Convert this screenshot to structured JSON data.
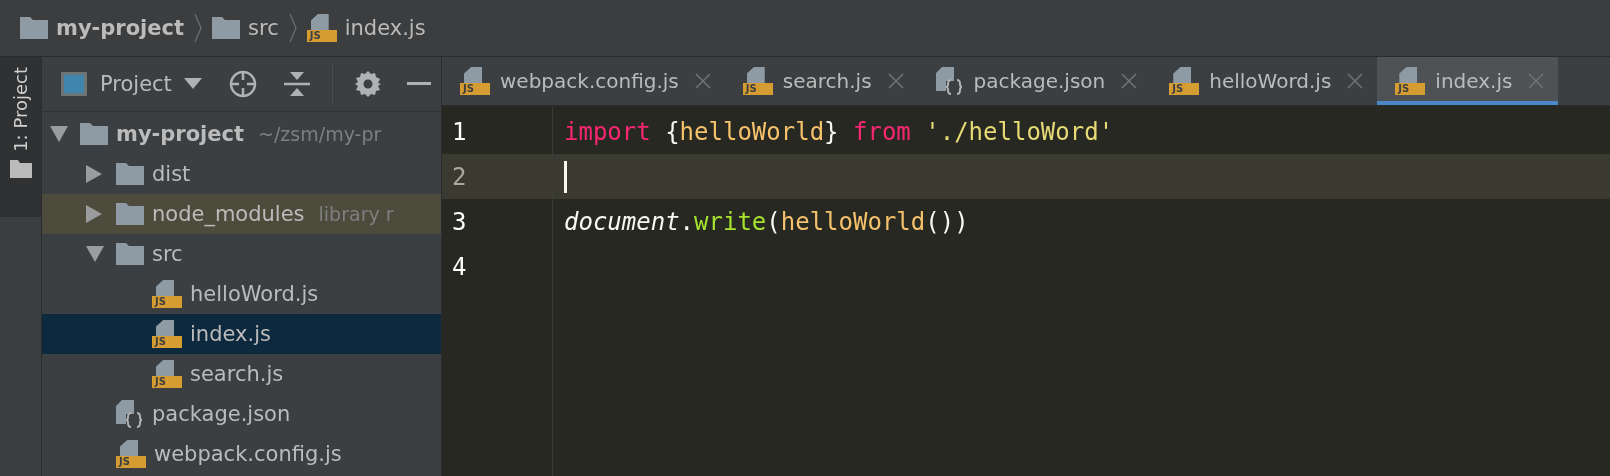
{
  "breadcrumb": [
    {
      "label": "my-project",
      "kind": "folder",
      "bold": true
    },
    {
      "label": "src",
      "kind": "folder",
      "bold": false
    },
    {
      "label": "index.js",
      "kind": "js",
      "badge": "JS",
      "bold": false
    }
  ],
  "side_stripe": {
    "label": "1: Project"
  },
  "project_panel": {
    "title": "Project"
  },
  "tree": [
    {
      "label": "my-project",
      "hint": "~/zsm/my-pr",
      "kind": "folder",
      "bold": true,
      "expanded": true,
      "selected": false,
      "excluded": false,
      "children": [
        {
          "label": "dist",
          "kind": "folder",
          "bold": false,
          "expanded": false,
          "selected": false,
          "excluded": false
        },
        {
          "label": "node_modules",
          "hint": "library r",
          "kind": "folder",
          "bold": false,
          "expanded": false,
          "selected": false,
          "excluded": true
        },
        {
          "label": "src",
          "kind": "folder",
          "bold": false,
          "expanded": true,
          "selected": false,
          "excluded": false,
          "children": [
            {
              "label": "helloWord.js",
              "kind": "js",
              "badge": "JS",
              "bold": false,
              "selected": false,
              "excluded": false
            },
            {
              "label": "index.js",
              "kind": "js",
              "badge": "JS",
              "bold": false,
              "selected": true,
              "excluded": false
            },
            {
              "label": "search.js",
              "kind": "js",
              "badge": "JS",
              "bold": false,
              "selected": false,
              "excluded": false
            }
          ]
        },
        {
          "label": "package.json",
          "kind": "json",
          "bold": false,
          "selected": false,
          "excluded": false
        },
        {
          "label": "webpack.config.js",
          "kind": "js",
          "badge": "JS",
          "bold": false,
          "selected": false,
          "excluded": false
        }
      ]
    }
  ],
  "tabs": [
    {
      "label": "webpack.config.js",
      "kind": "js",
      "badge": "JS",
      "selected": false
    },
    {
      "label": "search.js",
      "kind": "js",
      "badge": "JS",
      "selected": false
    },
    {
      "label": "package.json",
      "kind": "json",
      "selected": false
    },
    {
      "label": "helloWord.js",
      "kind": "js",
      "badge": "JS",
      "selected": false
    },
    {
      "label": "index.js",
      "kind": "js",
      "badge": "JS",
      "selected": true
    }
  ],
  "editor": {
    "lines": [
      {
        "number": "1",
        "current": false,
        "cursor": false,
        "tokens": [
          {
            "text": "import",
            "kind": "keyword"
          },
          {
            "text": " {",
            "kind": "plain"
          },
          {
            "text": "helloWorld",
            "kind": "ident"
          },
          {
            "text": "} ",
            "kind": "plain"
          },
          {
            "text": "from",
            "kind": "keyword"
          },
          {
            "text": " './helloWord'",
            "kind": "string"
          }
        ]
      },
      {
        "number": "2",
        "current": true,
        "cursor": true
      },
      {
        "number": "3",
        "current": false,
        "cursor": false,
        "tokens": [
          {
            "text": "document",
            "kind": "object"
          },
          {
            "text": ".",
            "kind": "plain"
          },
          {
            "text": "write",
            "kind": "method"
          },
          {
            "text": "(",
            "kind": "plain"
          },
          {
            "text": "helloWorld",
            "kind": "ident"
          },
          {
            "text": "())",
            "kind": "plain"
          }
        ]
      },
      {
        "number": "4",
        "current": false,
        "cursor": false
      }
    ]
  }
}
